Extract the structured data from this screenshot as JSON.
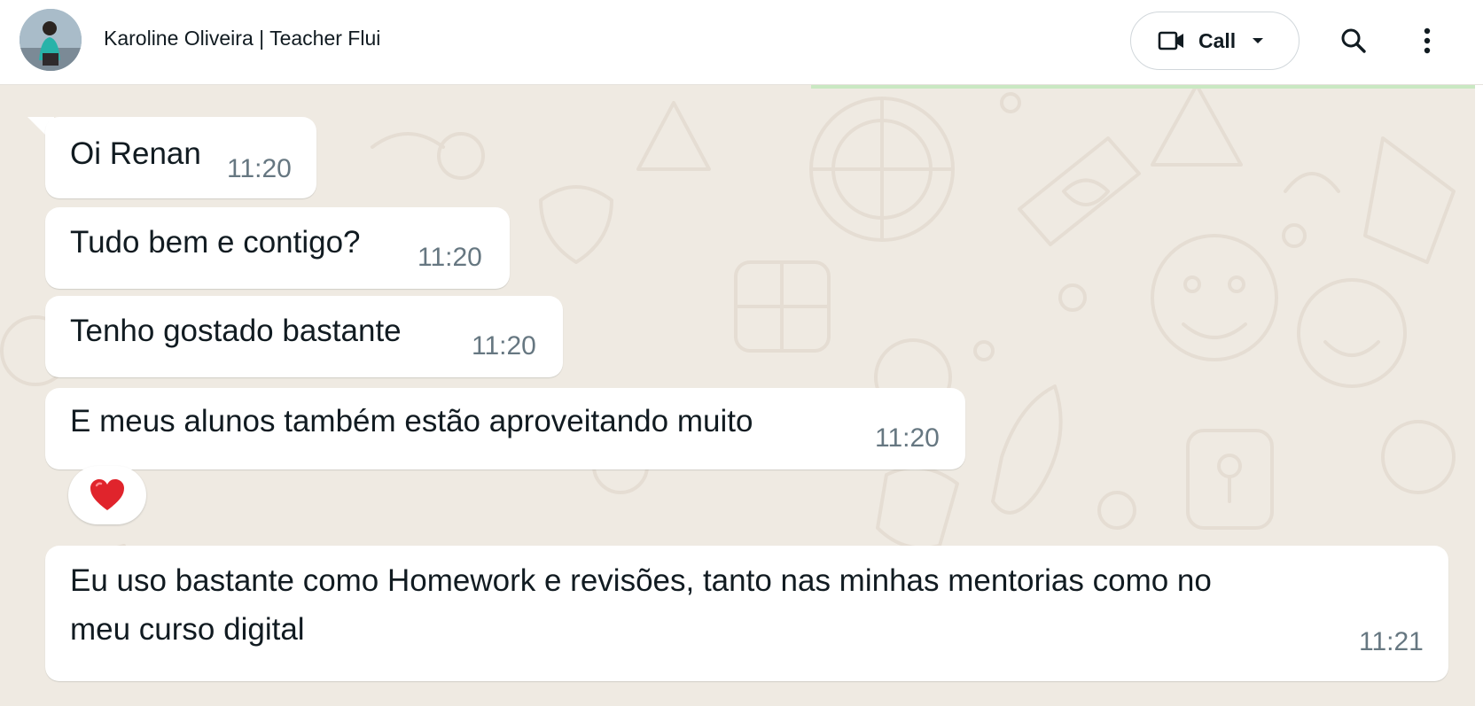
{
  "header": {
    "contact_name": "Karoline Oliveira | Teacher Flui",
    "call_label": "Call",
    "icons": {
      "avatar": "profile-photo",
      "call": "video-camera-icon",
      "call_dropdown": "caret-down-icon",
      "search": "search-icon",
      "menu": "kebab-menu-icon"
    }
  },
  "messages": [
    {
      "text": "Oi Renan",
      "time": "11:20"
    },
    {
      "text": "Tudo bem e contigo?",
      "time": "11:20"
    },
    {
      "text": "Tenho gostado bastante",
      "time": "11:20"
    },
    {
      "text": "E meus alunos também estão aproveitando muito",
      "time": "11:20",
      "reaction": "❤️"
    },
    {
      "text_lines": [
        "Eu uso bastante como Homework e revisões, tanto nas minhas mentorias como no",
        "meu curso digital"
      ],
      "time": "11:21"
    }
  ],
  "colors": {
    "chat_background": "#efeae2",
    "bubble": "#ffffff",
    "text": "#111b21",
    "timestamp": "#667781",
    "reaction_heart": "#e0242c"
  }
}
